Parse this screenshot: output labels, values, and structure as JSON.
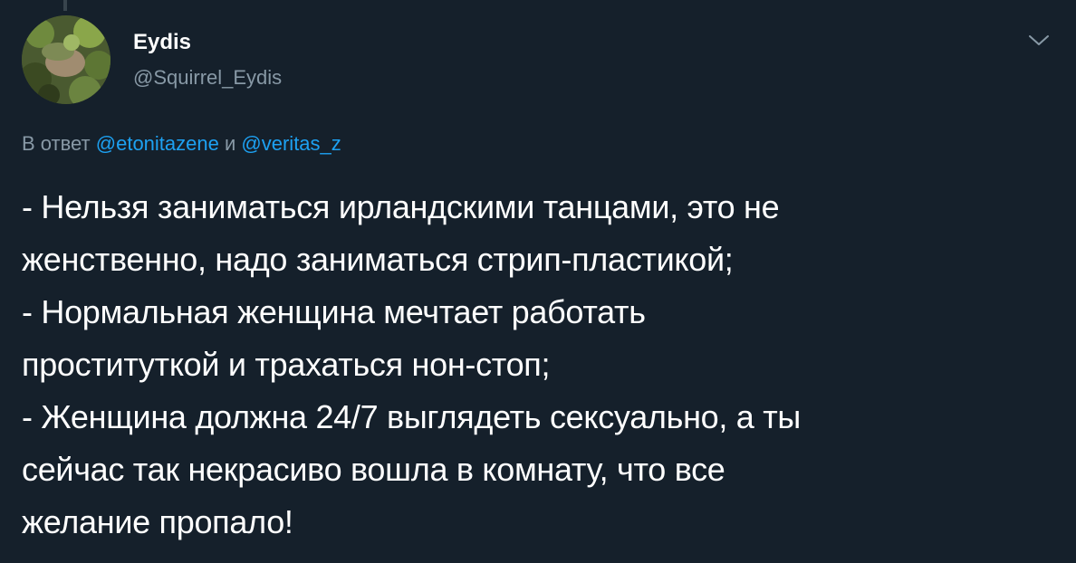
{
  "tweet": {
    "author": {
      "display_name": "Eydis",
      "handle": "@Squirrel_Eydis"
    },
    "reply": {
      "prefix": "В ответ",
      "mention_1": "@etonitazene",
      "joiner": "и",
      "mention_2": "@veritas_z"
    },
    "text_lines": [
      "- Нельзя заниматься ирландскими танцами, это не",
      "женственно, надо заниматься стрип-пластикой;",
      "- Нормальная женщина мечтает работать",
      "проституткой и трахаться нон-стоп;",
      "- Женщина должна 24/7 выглядеть сексуально, а ты",
      "сейчас так некрасиво вошла в комнату, что все",
      "желание пропало!"
    ]
  },
  "icons": {
    "more": "chevron-down-icon"
  },
  "colors": {
    "background": "#15202b",
    "text_primary": "#ffffff",
    "text_secondary": "#8899a6",
    "link": "#1da1f2"
  }
}
